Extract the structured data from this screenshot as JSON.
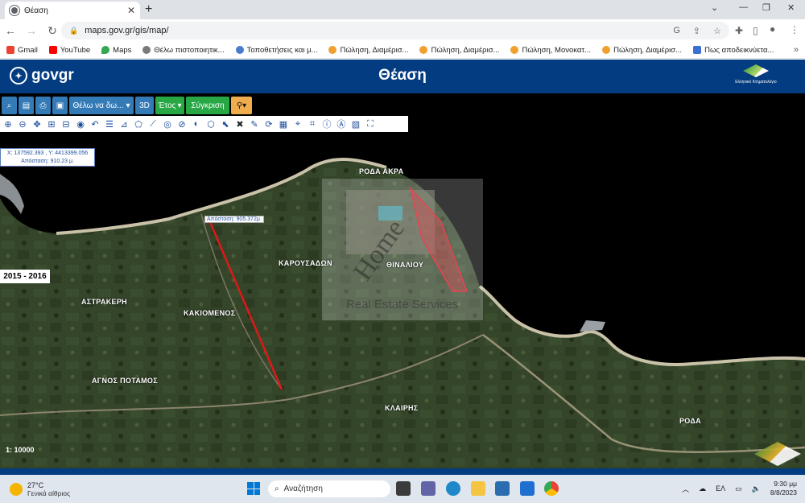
{
  "browser": {
    "tab_title": "Θέαση",
    "url": "maps.gov.gr/gis/map/",
    "bookmarks": [
      {
        "label": "Gmail",
        "color": "#ea4335"
      },
      {
        "label": "YouTube",
        "color": "#ff0000"
      },
      {
        "label": "Maps",
        "color": "#34a853"
      },
      {
        "label": "Θέλω πιστοποιητικ...",
        "color": "#7a7a7a"
      },
      {
        "label": "Τοποθετήσεις και μ...",
        "color": "#4a7bd0"
      },
      {
        "label": "Πώληση, Διαμέρισ...",
        "color": "#f0a030"
      },
      {
        "label": "Πώληση, Διαμέρισ...",
        "color": "#f0a030"
      },
      {
        "label": "Πώληση, Μονοκατ...",
        "color": "#f0a030"
      },
      {
        "label": "Πώληση, Διαμέρισ...",
        "color": "#f0a030"
      },
      {
        "label": "Πως αποδεικνύετα...",
        "color": "#3b6fd1"
      }
    ]
  },
  "header": {
    "logo_text": "govgr",
    "title": "Θέαση",
    "org_label": "Ελληνικό Κτηματολόγιο"
  },
  "toolbar": {
    "dropdown_label": "Θέλω να δω...",
    "btn_3d": "3D",
    "year_label": "Έτος",
    "compare_label": "Σύγκριση"
  },
  "map": {
    "coords": "X: 137592.393 , Y: 4413399.056",
    "distance_top": "Απόσταση: 910.23 μ.",
    "distance_line": "Απόσταση: 905.372μ.",
    "year": "2015 - 2016",
    "scale": "1: 10000",
    "watermark_name": "Home",
    "watermark_sub": "Real Estate Services",
    "places": [
      {
        "name": "ΡΟΔΑ ΑΚΡΑ"
      },
      {
        "name": "ΚΑΡΟΥΣΑΔΩΝ"
      },
      {
        "name": "ΘΙΝΑΛΙΟΥ"
      },
      {
        "name": "ΑΣΤΡΑΚΕΡΗ"
      },
      {
        "name": "ΚΑΚΙΟΜΕΝΟΣ"
      },
      {
        "name": "ΑΓΝΟΣ ΠΟΤΑΜΟΣ"
      },
      {
        "name": "ΚΛΑΙΡΗΣ"
      },
      {
        "name": "ΡΟΔΑ"
      }
    ]
  },
  "taskbar": {
    "temp": "27°C",
    "weather": "Γενικά αίθριος",
    "search": "Αναζήτηση",
    "lang": "ΕΛ",
    "time": "9:30 μμ",
    "date": "8/8/2023"
  }
}
